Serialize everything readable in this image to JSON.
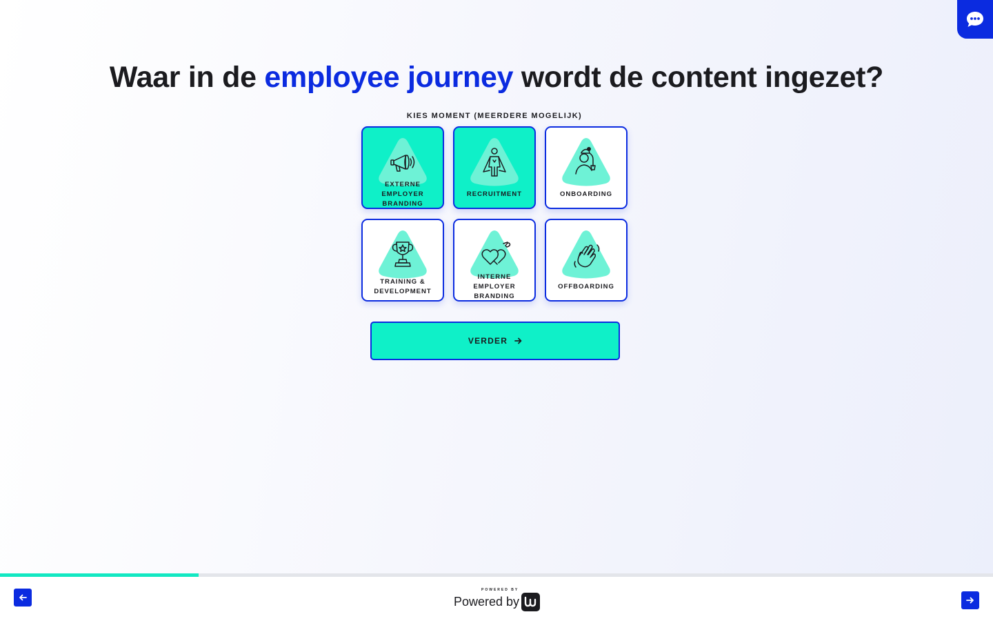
{
  "header": {
    "title_before": "Waar in de ",
    "title_accent": "employee journey",
    "title_after": " wordt de content ingezet?",
    "subtitle": "KIES MOMENT (MEERDERE MOGELIJK)"
  },
  "options": [
    {
      "label": "EXTERNE EMPLOYER BRANDING",
      "icon": "megaphone-icon",
      "selected": true
    },
    {
      "label": "RECRUITMENT",
      "icon": "superhero-icon",
      "selected": true
    },
    {
      "label": "ONBOARDING",
      "icon": "new-employee-icon",
      "selected": false
    },
    {
      "label": "TRAINING & DEVELOPMENT",
      "icon": "trophy-icon",
      "selected": false
    },
    {
      "label": "INTERNE EMPLOYER BRANDING",
      "icon": "hearts-icon",
      "selected": false
    },
    {
      "label": "OFFBOARDING",
      "icon": "waving-hand-icon",
      "selected": false
    }
  ],
  "actions": {
    "continue_label": "VERDER"
  },
  "progress": {
    "fraction": 0.2
  },
  "footer": {
    "powered_small": "POWERED BY",
    "powered_big": "Powered by"
  },
  "colors": {
    "accent": "#0b2be0",
    "selected": "#0ff0c8",
    "icon_bg": "#6ef2d6",
    "progress": "#12e8c2"
  }
}
